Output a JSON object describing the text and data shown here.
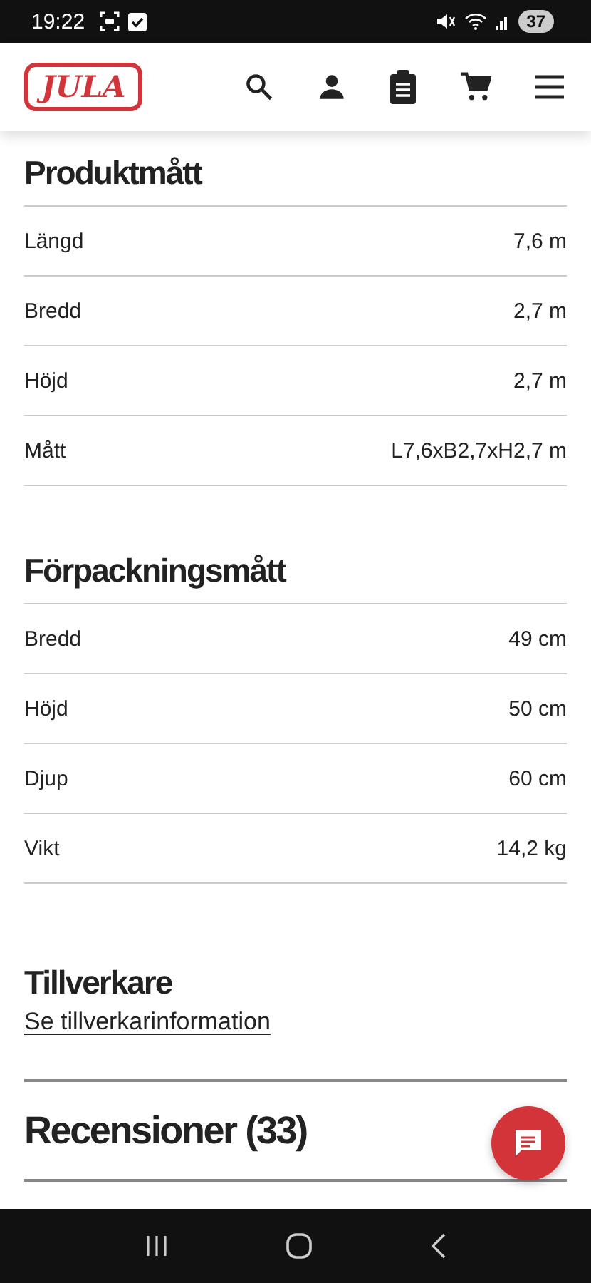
{
  "status_bar": {
    "time": "19:22",
    "battery": "37"
  },
  "header": {
    "logo": "JULA"
  },
  "sections": [
    {
      "title": "Produktmått",
      "rows": [
        {
          "label": "Längd",
          "value": "7,6 m"
        },
        {
          "label": "Bredd",
          "value": "2,7 m"
        },
        {
          "label": "Höjd",
          "value": "2,7 m"
        },
        {
          "label": "Mått",
          "value": "L7,6xB2,7xH2,7 m"
        }
      ]
    },
    {
      "title": "Förpackningsmått",
      "rows": [
        {
          "label": "Bredd",
          "value": "49 cm"
        },
        {
          "label": "Höjd",
          "value": "50 cm"
        },
        {
          "label": "Djup",
          "value": "60 cm"
        },
        {
          "label": "Vikt",
          "value": "14,2 kg"
        }
      ]
    }
  ],
  "manufacturer": {
    "title": "Tillverkare",
    "link": "Se tillverkarinformation"
  },
  "reviews": {
    "title": "Recensioner (33)"
  }
}
